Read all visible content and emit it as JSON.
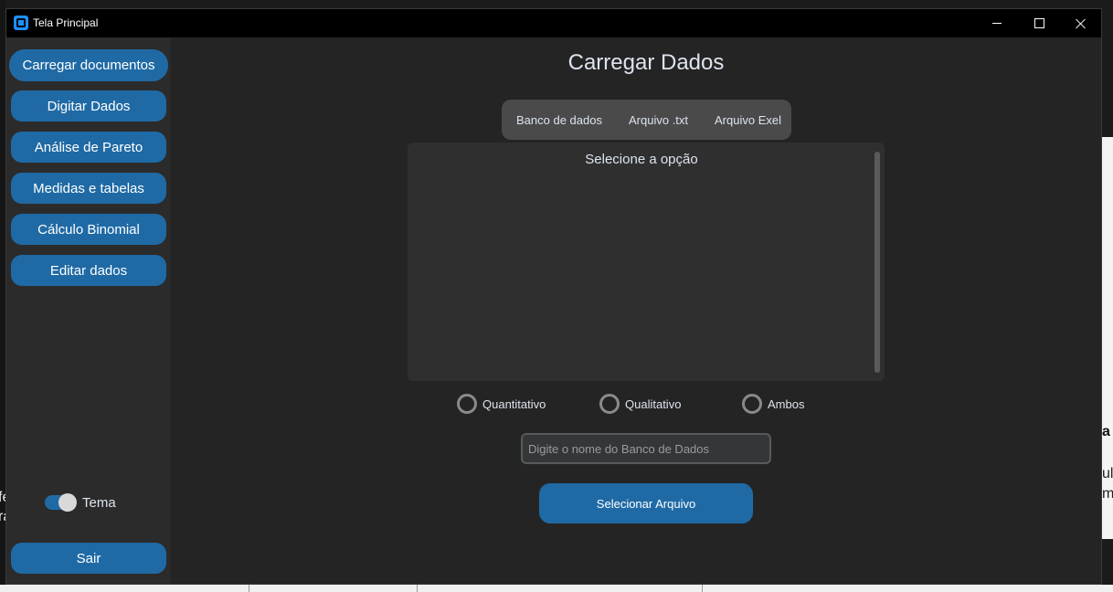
{
  "window": {
    "title": "Tela Principal"
  },
  "sidebar": {
    "buttons": [
      {
        "label": "Carregar documentos"
      },
      {
        "label": "Digitar Dados"
      },
      {
        "label": "Análise de Pareto"
      },
      {
        "label": "Medidas e tabelas"
      },
      {
        "label": "Cálculo Binomial"
      },
      {
        "label": "Editar dados"
      }
    ],
    "theme_label": "Tema",
    "theme_on": true,
    "exit_label": "Sair"
  },
  "main": {
    "title": "Carregar Dados",
    "tabs": [
      {
        "label": "Banco de dados"
      },
      {
        "label": "Arquivo .txt"
      },
      {
        "label": "Arquivo Exel"
      }
    ],
    "panel_title": "Selecione a opção",
    "radios": [
      {
        "label": "Quantitativo",
        "checked": false
      },
      {
        "label": "Qualitativo",
        "checked": false
      },
      {
        "label": "Ambos",
        "checked": false
      }
    ],
    "db_input": {
      "placeholder": "Digite o nome do Banco de Dados",
      "value": ""
    },
    "select_button_label": "Selecionar Arquivo"
  },
  "background": {
    "right_snippets": [
      "a",
      "ul",
      "m"
    ],
    "left_snippets": [
      "fe",
      "ra"
    ]
  },
  "colors": {
    "accent": "#1f6aa5",
    "window_bg": "#242424",
    "sidebar_bg": "#2b2b2b",
    "titlebar_bg": "#000000",
    "segmented_bg": "#4a4a4a",
    "panel_bg": "#2f2f2f"
  }
}
